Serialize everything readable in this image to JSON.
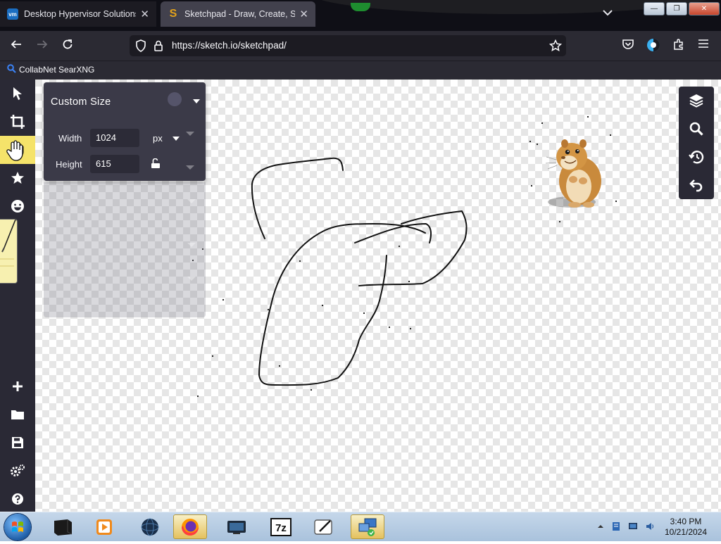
{
  "browser": {
    "tabs": [
      {
        "title": "Desktop Hypervisor Solutions |",
        "favicon": "vmware-icon",
        "active": false
      },
      {
        "title": "Sketchpad - Draw, Create, Share",
        "favicon": "sketchpad-icon",
        "active": true
      }
    ],
    "url": "https://sketch.io/sketchpad/",
    "bookmarks": [
      {
        "label": "CollabNet SearXNG",
        "icon": "search-icon"
      }
    ]
  },
  "app": {
    "left_toolbar": [
      {
        "name": "select-tool",
        "icon": "pointer-icon"
      },
      {
        "name": "crop-tool",
        "icon": "crop-icon"
      },
      {
        "name": "pan-tool",
        "icon": "hand-icon",
        "active": true
      },
      {
        "name": "stamp-tool",
        "icon": "star-icon"
      },
      {
        "name": "emoji-tool",
        "icon": "emoji-icon"
      },
      {
        "name": "new-button",
        "icon": "plus-icon"
      },
      {
        "name": "open-button",
        "icon": "folder-icon"
      },
      {
        "name": "save-button",
        "icon": "floppy-icon"
      },
      {
        "name": "settings-button",
        "icon": "gear-icon"
      },
      {
        "name": "help-button",
        "icon": "question-icon"
      }
    ],
    "size_panel": {
      "preset": "Custom Size",
      "width_label": "Width",
      "width_value": "1024",
      "unit": "px",
      "height_label": "Height",
      "height_value": "615"
    },
    "right_toolbar": [
      {
        "name": "layers-button",
        "icon": "layers-icon"
      },
      {
        "name": "zoom-button",
        "icon": "magnifier-icon"
      },
      {
        "name": "history-button",
        "icon": "history-icon"
      },
      {
        "name": "undo-button",
        "icon": "undo-icon"
      }
    ]
  },
  "taskbar": {
    "time": "3:40 PM",
    "date": "10/21/2024",
    "items": [
      "terminal-icon",
      "media-player-icon",
      "network-globe-icon",
      "firefox-icon",
      "remote-desktop-icon",
      "7zip-icon",
      "notepad-icon",
      "network-computer-icon"
    ]
  },
  "colors": {
    "toolbar_bg": "#2a2935",
    "panel_bg": "#3b3a48",
    "active_tool": "#f5e36a",
    "browser_bg": "#2b2a33"
  }
}
